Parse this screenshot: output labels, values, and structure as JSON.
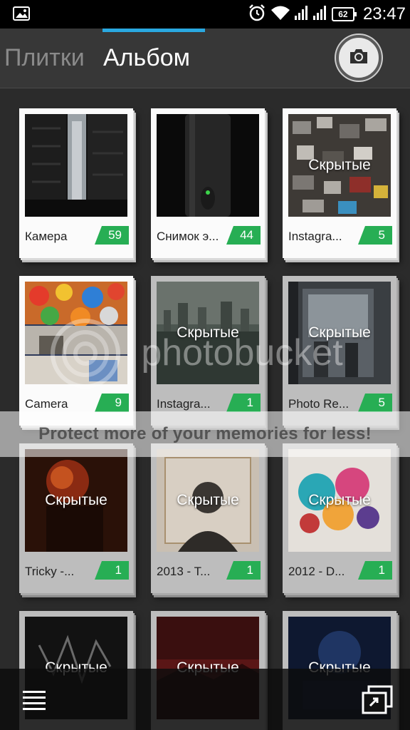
{
  "status_bar": {
    "time": "23:47",
    "battery": "62",
    "icons": [
      "gallery-icon",
      "alarm-icon",
      "wifi-icon",
      "signal-icon",
      "signal-icon",
      "battery-icon"
    ]
  },
  "tabs": [
    {
      "label": "Плитки",
      "active": false
    },
    {
      "label": "Альбом",
      "active": true
    }
  ],
  "camera_button": {
    "icon": "camera-icon"
  },
  "albums": [
    {
      "name": "Камера",
      "count": "59",
      "hidden": false
    },
    {
      "name": "Снимок э...",
      "count": "44",
      "hidden": false
    },
    {
      "name": "Instagra...",
      "count": "5",
      "hidden": true
    },
    {
      "name": "Camera",
      "count": "9",
      "hidden": false
    },
    {
      "name": "Instagra...",
      "count": "1",
      "hidden": true
    },
    {
      "name": "Photo Re...",
      "count": "5",
      "hidden": true
    },
    {
      "name": "Tricky -...",
      "count": "1",
      "hidden": true
    },
    {
      "name": "2013 - T...",
      "count": "1",
      "hidden": true
    },
    {
      "name": "2012 - D...",
      "count": "1",
      "hidden": true
    },
    {
      "name": "",
      "count": "",
      "hidden": true
    },
    {
      "name": "",
      "count": "",
      "hidden": true
    },
    {
      "name": "",
      "count": "",
      "hidden": true
    }
  ],
  "hidden_label": "Скрытые",
  "watermark": {
    "logo": "photobucket",
    "banner": "Protect more of your memories for less!"
  },
  "bottom_bar": {
    "menu_icon": "menu-icon",
    "window_icon": "window-icon"
  },
  "colors": {
    "accent": "#2aa8e0",
    "count_badge": "#27ae54",
    "background": "#2c2c2c"
  }
}
